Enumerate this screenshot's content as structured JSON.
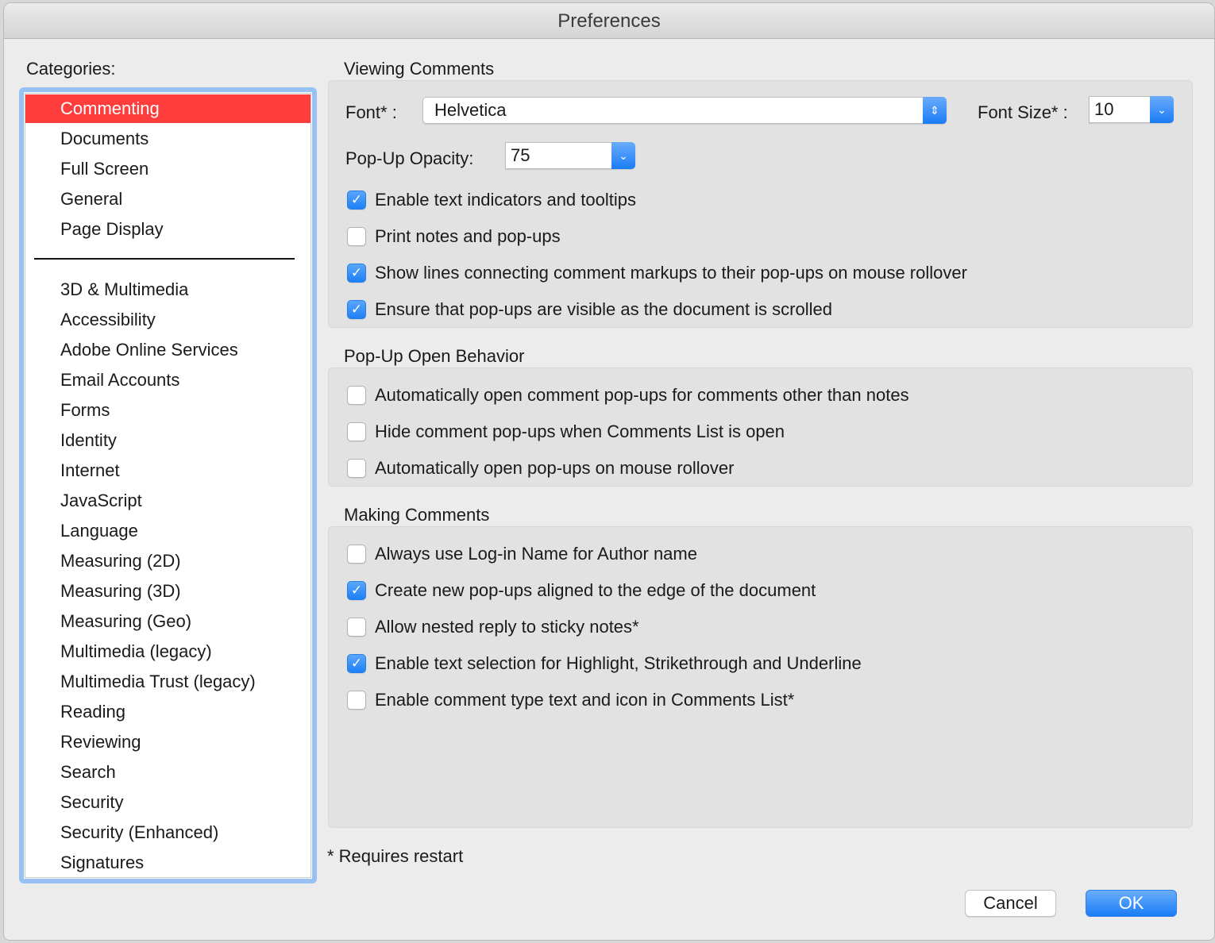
{
  "window": {
    "title": "Preferences"
  },
  "categories": {
    "label": "Categories:",
    "selected": "Commenting",
    "top_items": [
      "Commenting",
      "Documents",
      "Full Screen",
      "General",
      "Page Display"
    ],
    "items": [
      "3D & Multimedia",
      "Accessibility",
      "Adobe Online Services",
      "Email Accounts",
      "Forms",
      "Identity",
      "Internet",
      "JavaScript",
      "Language",
      "Measuring (2D)",
      "Measuring (3D)",
      "Measuring (Geo)",
      "Multimedia (legacy)",
      "Multimedia Trust (legacy)",
      "Reading",
      "Reviewing",
      "Search",
      "Security",
      "Security (Enhanced)",
      "Signatures"
    ]
  },
  "viewing_comments": {
    "title": "Viewing Comments",
    "font_label": "Font* :",
    "font_value": "Helvetica",
    "font_size_label": "Font Size* :",
    "font_size_value": "10",
    "opacity_label": "Pop-Up Opacity:",
    "opacity_value": "75",
    "options": [
      {
        "label": "Enable text indicators and tooltips",
        "checked": true
      },
      {
        "label": "Print notes and pop-ups",
        "checked": false
      },
      {
        "label": "Show lines connecting comment markups to their pop-ups on mouse rollover",
        "checked": true
      },
      {
        "label": "Ensure that pop-ups are visible as the document is scrolled",
        "checked": true
      }
    ]
  },
  "popup_open_behavior": {
    "title": "Pop-Up Open Behavior",
    "options": [
      {
        "label": "Automatically open comment pop-ups for comments other than notes",
        "checked": false
      },
      {
        "label": "Hide comment pop-ups when Comments List is open",
        "checked": false
      },
      {
        "label": "Automatically open pop-ups on mouse rollover",
        "checked": false
      }
    ]
  },
  "making_comments": {
    "title": "Making Comments",
    "options": [
      {
        "label": "Always use Log-in Name for Author name",
        "checked": false
      },
      {
        "label": "Create new pop-ups aligned to the edge of the document",
        "checked": true
      },
      {
        "label": "Allow nested reply to sticky notes*",
        "checked": false
      },
      {
        "label": "Enable text selection for Highlight, Strikethrough and Underline",
        "checked": true
      },
      {
        "label": "Enable comment type text and icon in Comments List*",
        "checked": false
      }
    ]
  },
  "footnote": "* Requires restart",
  "buttons": {
    "cancel": "Cancel",
    "ok": "OK"
  },
  "icons": {
    "check": "✓",
    "updown": "⇕",
    "chevron_down": "⌄"
  },
  "colors": {
    "selected": "#fe3d3c",
    "accent": "#1f80f6",
    "focus_ring": "#96c1f2"
  }
}
